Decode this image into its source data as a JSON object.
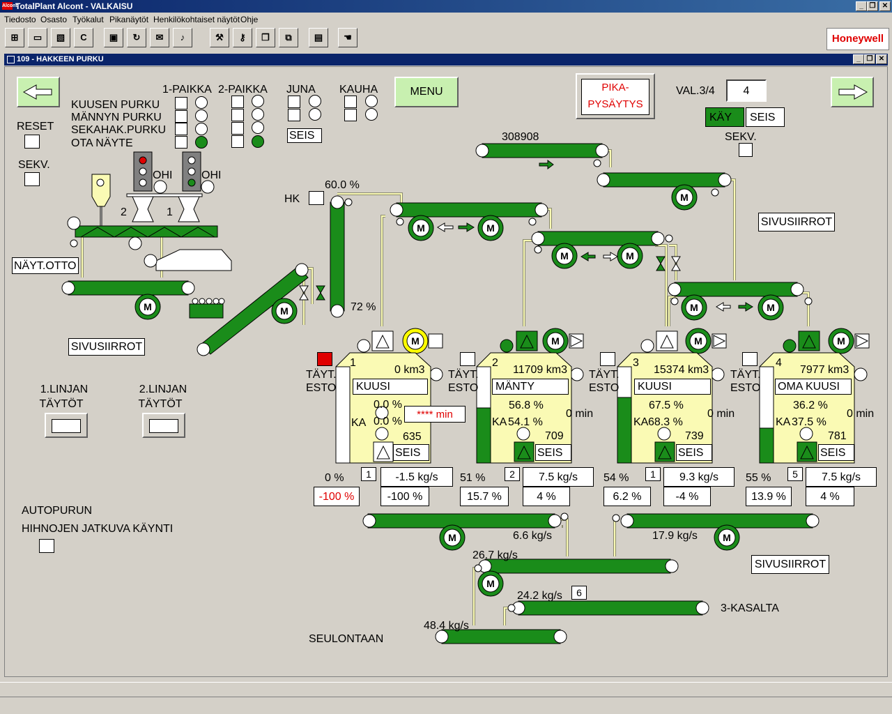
{
  "app": {
    "title": "TotalPlant Alcont - VALKAISU",
    "logo": "Honeywell",
    "window_title": "109 - HAKKEEN PURKU"
  },
  "menu": [
    "Tiedosto",
    "Osasto",
    "Työkalut",
    "Pikanäytöt",
    "Henkilökohtaiset näytöt",
    "Ohje"
  ],
  "toolbar": {
    "c_label": "C",
    "icons": [
      "network-icon",
      "page-icon",
      "image-icon",
      "c-icon",
      "display-icon",
      "refresh-icon",
      "mail-icon",
      "speaker-icon",
      "wrench-icon",
      "key-icon",
      "window-icon",
      "windows-icon",
      "document-icon",
      "hand-icon"
    ]
  },
  "controls": {
    "menu_label": "MENU",
    "pika": "PIKA-",
    "pysaytys": "PYSÄYTYS",
    "val": "VAL.3/4",
    "val_value": "4",
    "kay": "KÄY",
    "seis": "SEIS",
    "sekv_top": "SEKV.",
    "reset": "RESET",
    "sekv_left": "SEKV."
  },
  "selection": {
    "col1": "1-PAIKKA",
    "col2": "2-PAIKKA",
    "juna": "JUNA",
    "kauha": "KAUHA",
    "rows": [
      "KUUSEN PURKU",
      "MÄNNYN PURKU",
      "SEKAHAK.PURKU",
      "OTA NÄYTE"
    ],
    "juna_seis": "SEIS"
  },
  "feeder": {
    "ohi1": "OHI",
    "ohi2": "OHI",
    "num2": "2",
    "num1": "1",
    "nayt_otto": "NÄYT.OTTO",
    "sivusiirrot_left": "SIVUSIIRROT",
    "linja1_a": "1.LINJAN",
    "linja1_b": "TÄYTÖT",
    "linja2_a": "2.LINJAN",
    "linja2_b": "TÄYTÖT",
    "hk": "HK",
    "pct_top": "60.0 %",
    "pct_mid": "72 %",
    "counter": "308908",
    "sivusiirrot_right": "SIVUSIIRROT",
    "sivusiirrot_bottom": "SIVUSIIRROT",
    "autopurun": "AUTOPURUN",
    "jatkuva": "HIHNOJEN JATKUVA KÄYNTI"
  },
  "motor_label": "M",
  "silos": [
    {
      "num": "1",
      "km3": "0 km3",
      "type": "KUUSI",
      "pct1": "0.0 %",
      "ka": "KA",
      "ka_val": "0.0 %",
      "min": "**** min",
      "level": "635",
      "seis": "SEIS",
      "fill": 0.0,
      "tayt": "TÄYT.",
      "esto": "ESTO",
      "out_pct": "0 %",
      "out_id": "1",
      "flow": "-1.5 kg/s",
      "set": "-100 %",
      "bottom": "-100 %"
    },
    {
      "num": "2",
      "km3": "11709 km3",
      "type": "MÄNTY",
      "pct1": "56.8 %",
      "ka": "KA",
      "ka_val": "54.1 %",
      "min": "0 min",
      "level": "709",
      "seis": "SEIS",
      "fill": 0.57,
      "tayt": "TÄYT.",
      "esto": "ESTO",
      "out_pct": "51 %",
      "out_id": "2",
      "flow": "7.5 kg/s",
      "set": "15.7 %",
      "bottom": "4 %"
    },
    {
      "num": "3",
      "km3": "15374 km3",
      "type": "KUUSI",
      "pct1": "67.5 %",
      "ka": "KA",
      "ka_val": "68.3 %",
      "min": "0 min",
      "level": "739",
      "seis": "SEIS",
      "fill": 0.68,
      "tayt": "TÄYT.",
      "esto": "ESTO",
      "out_pct": "54 %",
      "out_id": "1",
      "flow": "9.3 kg/s",
      "set": "6.2 %",
      "bottom": "-4 %"
    },
    {
      "num": "4",
      "km3": "7977 km3",
      "type": "OMA KUUSI",
      "pct1": "36.2 %",
      "ka": "KA",
      "ka_val": "37.5 %",
      "min": "0 min",
      "level": "781",
      "seis": "SEIS",
      "fill": 0.36,
      "tayt": "TÄYT.",
      "esto": "ESTO",
      "out_pct": "55 %",
      "out_id": "5",
      "flow": "7.5 kg/s",
      "set": "13.9 %",
      "bottom": "4 %"
    }
  ],
  "flows": {
    "f1": "6.6 kg/s",
    "f2": "17.9 kg/s",
    "f3": "26.7 kg/s",
    "f4": "24.2 kg/s",
    "f4_id": "6",
    "f5": "48.4 kg/s",
    "kasalta": "3-KASALTA",
    "seulontaan": "SEULONTAAN"
  },
  "colors": {
    "belt": "#1a8c1a",
    "silo": "#fafab4",
    "panel": "#d4d0c8",
    "alarm": "#e00000",
    "button": "#c8f0b0"
  }
}
